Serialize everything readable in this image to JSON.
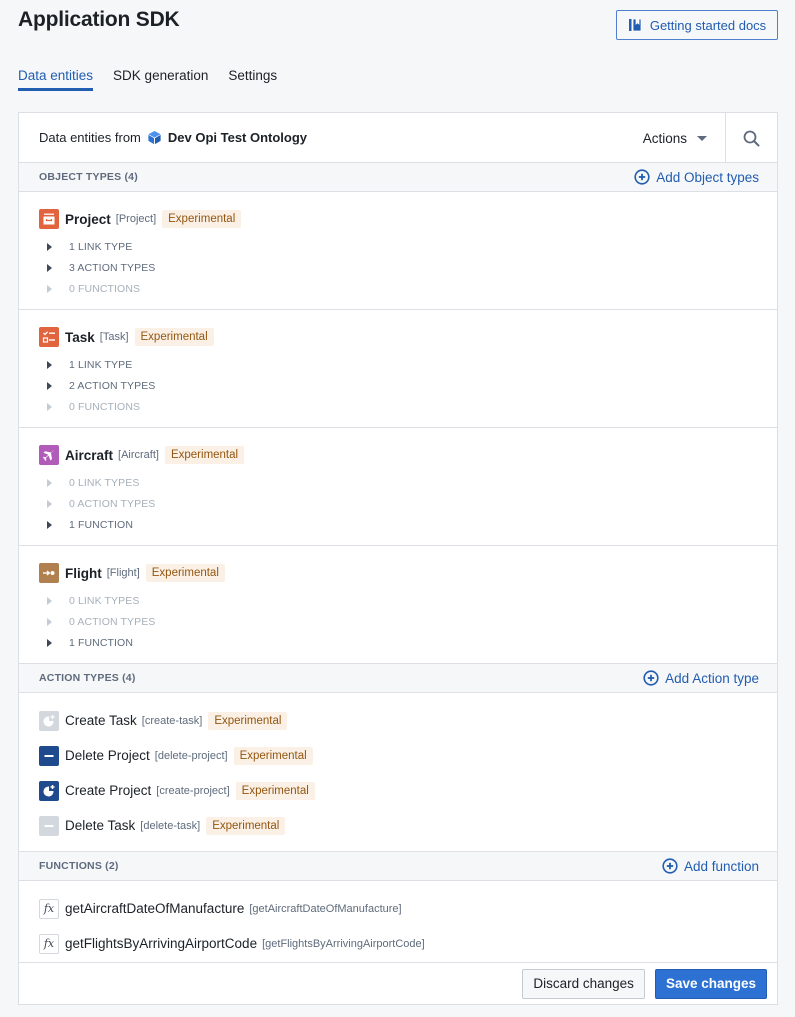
{
  "header": {
    "title": "Application SDK",
    "docs_button": "Getting started docs"
  },
  "tabs": [
    {
      "label": "Data entities",
      "active": true
    },
    {
      "label": "SDK generation",
      "active": false
    },
    {
      "label": "Settings",
      "active": false
    }
  ],
  "panel": {
    "source_prefix": "Data entities from",
    "ontology_name": "Dev Opi Test Ontology",
    "actions_label": "Actions"
  },
  "object_types": {
    "title": "OBJECT TYPES (4)",
    "add_label": "Add Object types",
    "items": [
      {
        "name": "Project",
        "api_name": "[Project]",
        "badge": "Experimental",
        "icon": "archive-icon",
        "icon_color": "#e2643e",
        "rows": [
          {
            "label": "1 LINK TYPE",
            "disabled": false
          },
          {
            "label": "3 ACTION TYPES",
            "disabled": false
          },
          {
            "label": "0 FUNCTIONS",
            "disabled": true
          }
        ]
      },
      {
        "name": "Task",
        "api_name": "[Task]",
        "badge": "Experimental",
        "icon": "checklist-icon",
        "icon_color": "#e2643e",
        "rows": [
          {
            "label": "1 LINK TYPE",
            "disabled": false
          },
          {
            "label": "2 ACTION TYPES",
            "disabled": false
          },
          {
            "label": "0 FUNCTIONS",
            "disabled": true
          }
        ]
      },
      {
        "name": "Aircraft",
        "api_name": "[Aircraft]",
        "badge": "Experimental",
        "icon": "airplane-icon",
        "icon_color": "#b05cb8",
        "rows": [
          {
            "label": "0 LINK TYPES",
            "disabled": true
          },
          {
            "label": "0 ACTION TYPES",
            "disabled": true
          },
          {
            "label": "1 FUNCTION",
            "disabled": false
          }
        ]
      },
      {
        "name": "Flight",
        "api_name": "[Flight]",
        "badge": "Experimental",
        "icon": "arrow-to-dot-icon",
        "icon_color": "#b0814f",
        "rows": [
          {
            "label": "0 LINK TYPES",
            "disabled": true
          },
          {
            "label": "0 ACTION TYPES",
            "disabled": true
          },
          {
            "label": "1 FUNCTION",
            "disabled": false
          }
        ]
      }
    ]
  },
  "action_types": {
    "title": "ACTION TYPES (4)",
    "add_label": "Add Action type",
    "items": [
      {
        "name": "Create Task",
        "api_name": "[create-task]",
        "badge": "Experimental",
        "icon": "create-icon",
        "icon_color": "#d3d8de"
      },
      {
        "name": "Delete Project",
        "api_name": "[delete-project]",
        "badge": "Experimental",
        "icon": "delete-icon",
        "icon_color": "#1f4b8e"
      },
      {
        "name": "Create Project",
        "api_name": "[create-project]",
        "badge": "Experimental",
        "icon": "create-icon",
        "icon_color": "#1f4b8e"
      },
      {
        "name": "Delete Task",
        "api_name": "[delete-task]",
        "badge": "Experimental",
        "icon": "delete-icon",
        "icon_color": "#d3d8de"
      }
    ]
  },
  "functions": {
    "title": "FUNCTIONS (2)",
    "add_label": "Add function",
    "items": [
      {
        "name": "getAircraftDateOfManufacture",
        "api_name": "[getAircraftDateOfManufacture]",
        "icon_text": "fx"
      },
      {
        "name": "getFlightsByArrivingAirportCode",
        "api_name": "[getFlightsByArrivingAirportCode]",
        "icon_text": "fx"
      }
    ]
  },
  "footer": {
    "discard_label": "Discard changes",
    "save_label": "Save changes"
  },
  "colors": {
    "accent": "#215db0",
    "primary_button": "#2d72d2",
    "badge_text": "#935610",
    "badge_bg": "#fbf0e5"
  }
}
